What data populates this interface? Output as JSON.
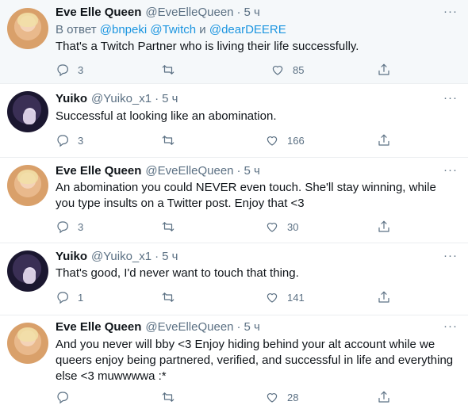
{
  "tweets": [
    {
      "name": "Eve Elle Queen",
      "handle": "@EveElleQueen",
      "sep": "·",
      "time": "5 ч",
      "reply_prefix": "В ответ",
      "mentions": [
        "@bnpeki",
        "@Twitch",
        "и",
        "@dearDEERE"
      ],
      "text": "That's a Twitch Partner who is living their life successfully.",
      "replies": "3",
      "likes": "85",
      "avatar": "eve"
    },
    {
      "name": "Yuiko",
      "handle": "@Yuiko_x1",
      "sep": "·",
      "time": "5 ч",
      "text": "Successful at looking like an abomination.",
      "replies": "3",
      "likes": "166",
      "avatar": "yuiko"
    },
    {
      "name": "Eve Elle Queen",
      "handle": "@EveElleQueen",
      "sep": "·",
      "time": "5 ч",
      "text": "An abomination you could NEVER even touch. She'll stay winning, while you type insults on a Twitter post. Enjoy that <3",
      "replies": "3",
      "likes": "30",
      "avatar": "eve"
    },
    {
      "name": "Yuiko",
      "handle": "@Yuiko_x1",
      "sep": "·",
      "time": "5 ч",
      "text": "That's good, I'd never want to touch that thing.",
      "replies": "1",
      "likes": "141",
      "avatar": "yuiko"
    },
    {
      "name": "Eve Elle Queen",
      "handle": "@EveElleQueen",
      "sep": "·",
      "time": "5 ч",
      "text": "And you never will bby <3 Enjoy hiding behind your alt account while we queers enjoy being partnered, verified, and successful in life and everything else <3 muwwwwa :*",
      "replies": "",
      "likes": "28",
      "avatar": "eve"
    }
  ],
  "more_glyph": "···",
  "icons": {
    "reply": "reply-icon",
    "retweet": "retweet-icon",
    "like": "heart-icon",
    "share": "share-icon",
    "more": "more-icon"
  },
  "colors": {
    "muted": "#5b7083",
    "mention": "#1b95e0",
    "highlight_bg": "#f5f8fa"
  }
}
